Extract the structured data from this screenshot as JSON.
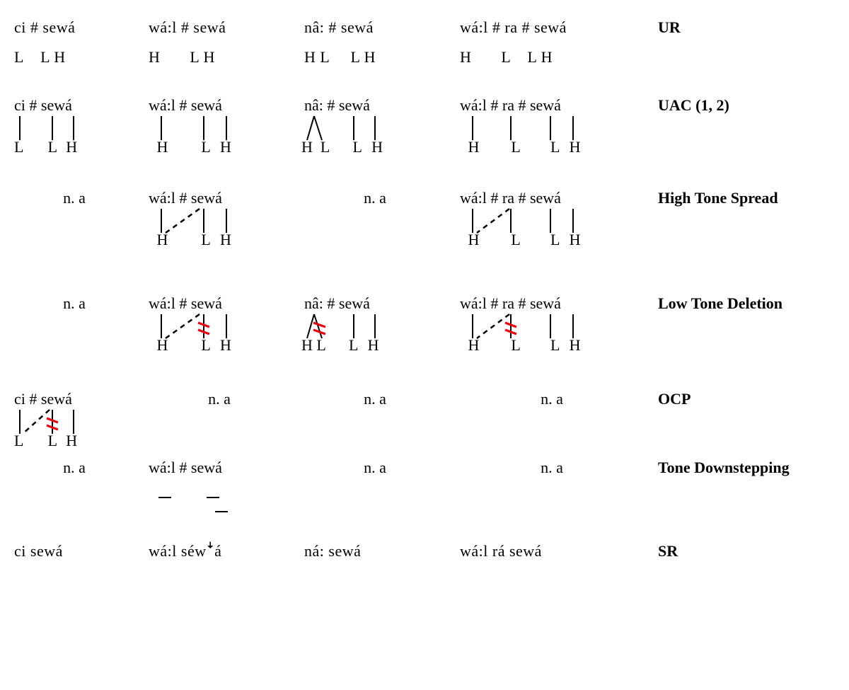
{
  "labels": {
    "ur": "UR",
    "uac": "UAC (1, 2)",
    "hts": "High Tone Spread",
    "ltd": "Low Tone Deletion",
    "ocp": "OCP",
    "tds": "Tone Downstepping",
    "sr": "SR",
    "na": "n. a"
  },
  "col1": {
    "ur_seg": "ci # sewá",
    "ur_tone": "L    L H",
    "uac_seg": "ci # sewá",
    "ocp_seg": "ci # sewá",
    "sr": "ci   sewá"
  },
  "col2": {
    "ur_seg": "wá:l # sewá",
    "ur_tone": "H       L H",
    "uac_seg": "wá:l # sewá",
    "hts_seg": "wá:l # sewá",
    "ltd_seg": "wá:l # sewá",
    "tds_seg": "wá:l # sewá",
    "sr": "wá:l   séwꜜá"
  },
  "col3": {
    "ur_seg": "nâ: # sewá",
    "ur_tone": "H L     L H",
    "uac_seg": "nâ: # sewá",
    "ltd_seg": "nâ: # sewá",
    "sr": "ná:   sewá"
  },
  "col4": {
    "ur_seg": "wá:l # ra # sewá",
    "ur_tone": "H       L    L H",
    "uac_seg": "wá:l # ra # sewá",
    "hts_seg": "wá:l # ra # sewá",
    "ltd_seg": "wá:l # ra # sewá",
    "sr": "wá:l   rá   sewá"
  },
  "tones": {
    "L": "L",
    "H": "H"
  }
}
